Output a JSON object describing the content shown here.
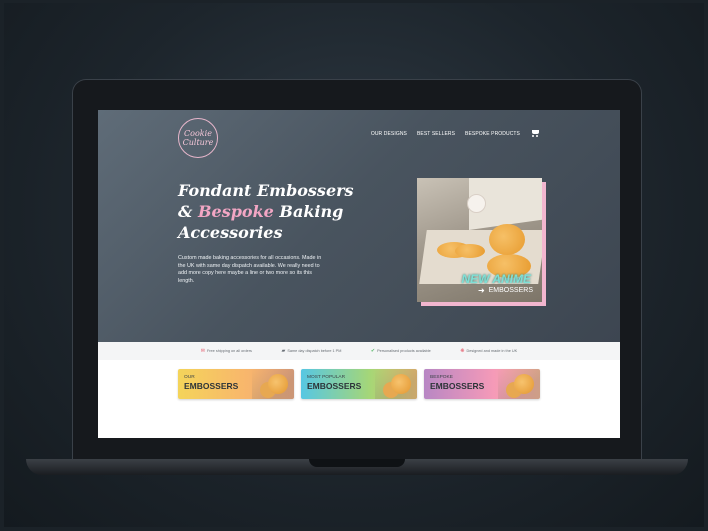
{
  "brand": {
    "logo_line1": "Cookie",
    "logo_line2": "Culture"
  },
  "nav": {
    "items": [
      "OUR DESIGNS",
      "BEST SELLERS",
      "BESPOKE PRODUCTS"
    ],
    "cart_icon": "cart-icon"
  },
  "hero": {
    "title_line1": "Fondant Embossers",
    "title_amp": "& ",
    "title_pink": "Bespoke",
    "title_line2_rest": " Baking",
    "title_line3": "Accessories",
    "description": "Custom made baking accessories for all occasions. Made in the UK with same day dispatch available. We really need to add more copy here maybe a line or two more so its this length.",
    "card": {
      "title": "NEW ANIME",
      "cta": "EMBOSSERS",
      "cta_icon": "arrow-right-icon"
    }
  },
  "features": [
    {
      "icon": "✉",
      "text": "Free shipping on all orders",
      "color": "#e55a6a"
    },
    {
      "icon": "▰",
      "text": "Same day dispatch before 1 PM",
      "color": "#6b7178"
    },
    {
      "icon": "✔",
      "text": "Personalised products available",
      "color": "#5ab86a"
    },
    {
      "icon": "❋",
      "text": "Designed and made in the UK",
      "color": "#e55a6a"
    }
  ],
  "categories": [
    {
      "small": "OUR",
      "large": "EMBOSSERS"
    },
    {
      "small": "MOST POPULAR",
      "large": "EMBOSSERS"
    },
    {
      "small": "BESPOKE",
      "large": "EMBOSSERS"
    }
  ],
  "colors": {
    "accent_pink": "#f2a6c4",
    "accent_teal": "#7fe0d6",
    "hero_bg": "#4d5864"
  }
}
